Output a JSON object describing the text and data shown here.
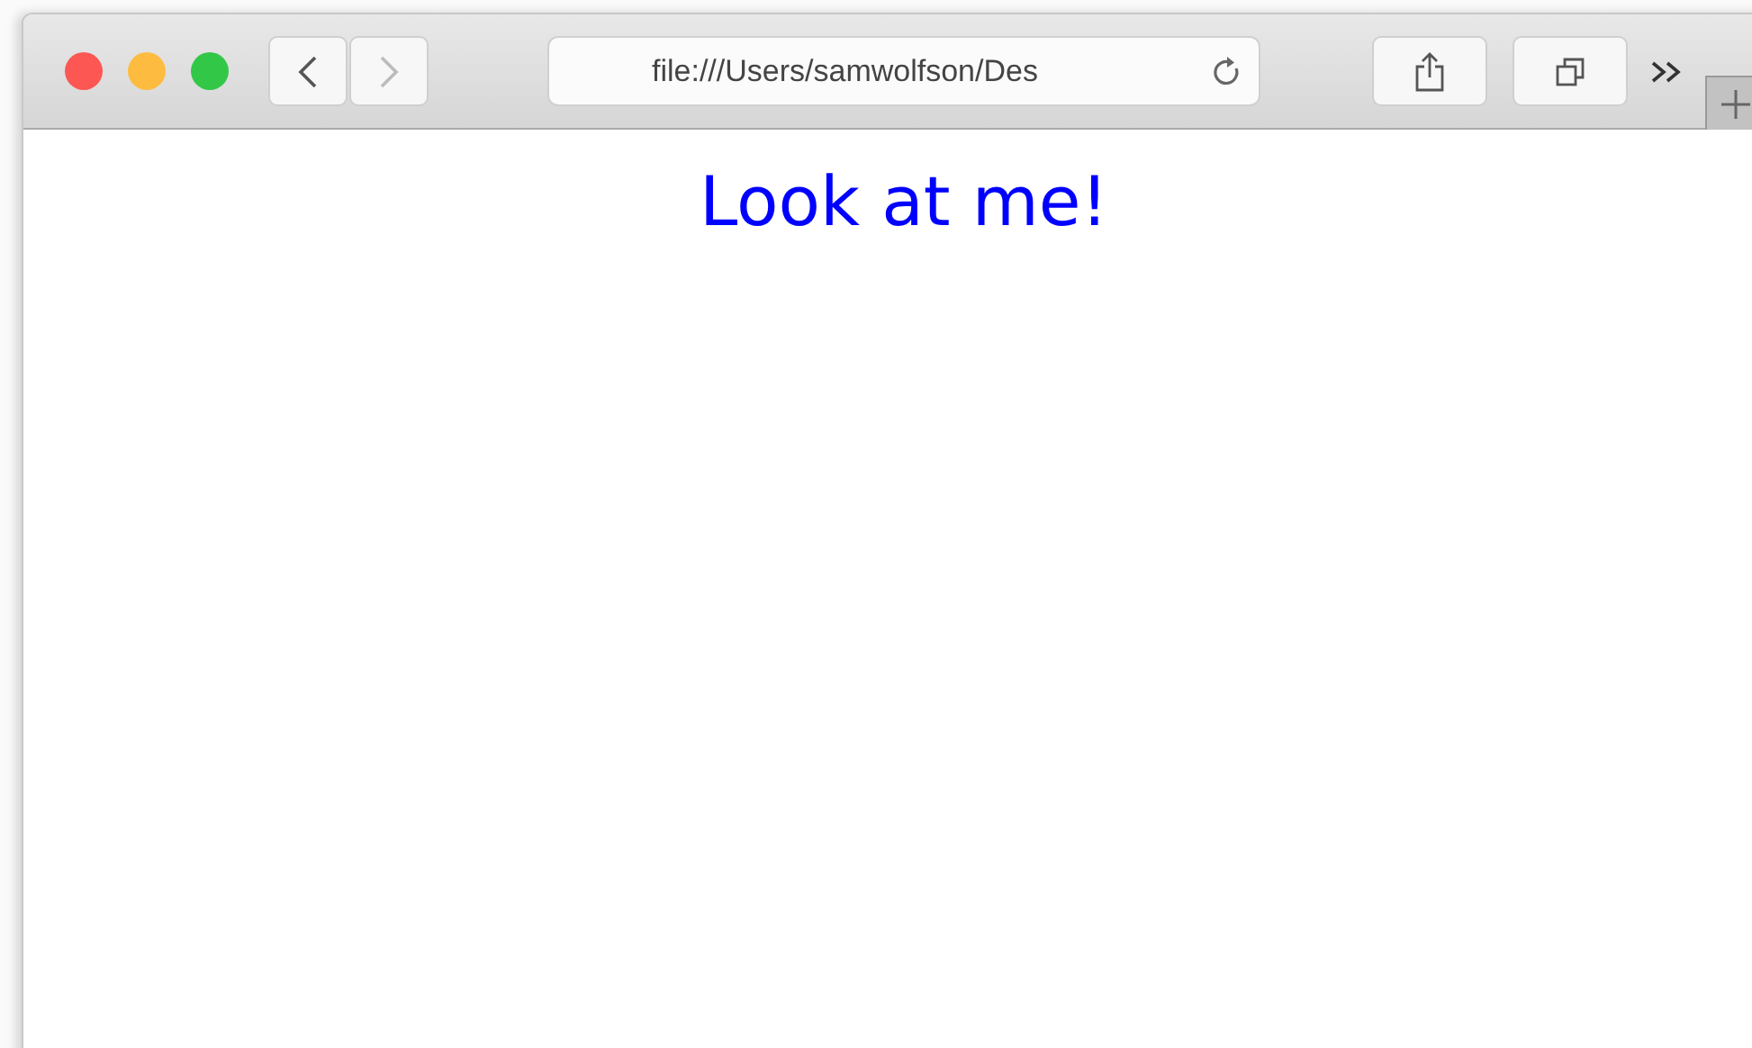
{
  "toolbar": {
    "address": "file:///Users/samwolfson/Des"
  },
  "page": {
    "heading": "Look at me!"
  }
}
